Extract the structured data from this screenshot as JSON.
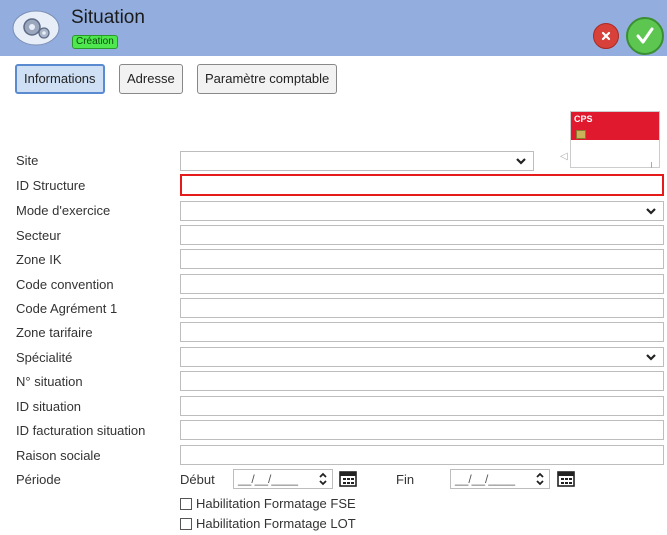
{
  "header": {
    "title": "Situation",
    "mode_badge": "Création"
  },
  "tabs": [
    {
      "label": "Informations",
      "active": true
    },
    {
      "label": "Adresse",
      "active": false
    },
    {
      "label": "Paramètre comptable",
      "active": false
    }
  ],
  "card": {
    "label": "CPS"
  },
  "form": {
    "fields": [
      {
        "label": "Site",
        "type": "select",
        "value": ""
      },
      {
        "label": "ID Structure",
        "type": "text",
        "value": "",
        "error": true
      },
      {
        "label": "Mode d'exercice",
        "type": "select",
        "value": ""
      },
      {
        "label": "Secteur",
        "type": "text",
        "value": ""
      },
      {
        "label": "Zone IK",
        "type": "text",
        "value": ""
      },
      {
        "label": "Code convention",
        "type": "text",
        "value": ""
      },
      {
        "label": "Code Agrément 1",
        "type": "text",
        "value": ""
      },
      {
        "label": "Zone tarifaire",
        "type": "text",
        "value": ""
      },
      {
        "label": "Spécialité",
        "type": "select",
        "value": ""
      },
      {
        "label": "N° situation",
        "type": "text",
        "value": ""
      },
      {
        "label": "ID situation",
        "type": "text",
        "value": ""
      },
      {
        "label": "ID facturation situation",
        "type": "text",
        "value": ""
      },
      {
        "label": "Raison sociale",
        "type": "text",
        "value": ""
      }
    ],
    "periode": {
      "label": "Période",
      "debut_label": "Début",
      "fin_label": "Fin",
      "debut_value": "__/__/____",
      "fin_value": "__/__/____"
    },
    "checkboxes": [
      {
        "label": "Habilitation Formatage FSE",
        "checked": false
      },
      {
        "label": "Habilitation Formatage LOT",
        "checked": false
      }
    ]
  },
  "colors": {
    "header_bg": "#93aede",
    "error_border": "#e51a1a",
    "ok_green": "#5cc651",
    "close_red": "#d8413a",
    "badge_green": "#4ee84e"
  },
  "icons": [
    "settings-gears-icon",
    "close-icon",
    "check-icon",
    "chevron-down-icon",
    "spin-arrows-icon",
    "calendar-icon"
  ]
}
